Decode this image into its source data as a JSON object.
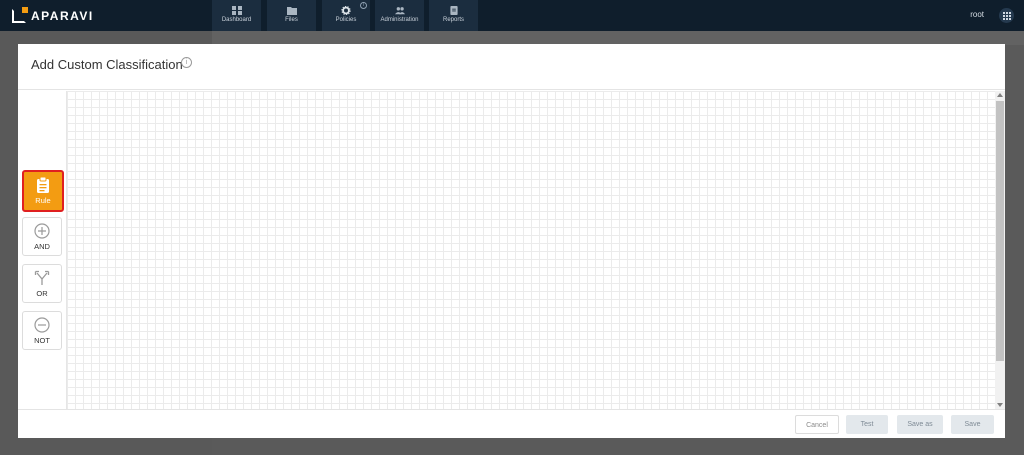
{
  "app": {
    "brand": "APARAVI",
    "user": "root",
    "nav": [
      {
        "label": "Dashboard",
        "icon": "dashboard-icon"
      },
      {
        "label": "Files",
        "icon": "folder-icon"
      },
      {
        "label": "Policies",
        "icon": "gear-icon"
      },
      {
        "label": "Administration",
        "icon": "users-icon"
      },
      {
        "label": "Reports",
        "icon": "report-icon"
      }
    ]
  },
  "modal": {
    "title": "Add Custom Classification",
    "palette": [
      {
        "label": "Rule",
        "icon": "clipboard-icon",
        "selected": true
      },
      {
        "label": "AND",
        "icon": "plus-circle-icon"
      },
      {
        "label": "OR",
        "icon": "split-arrows-icon"
      },
      {
        "label": "NOT",
        "icon": "minus-circle-icon"
      }
    ],
    "footer": {
      "cancel": "Cancel",
      "test": "Test",
      "save_as": "Save as",
      "save": "Save"
    }
  },
  "colors": {
    "topbar": "#0f1e2c",
    "accent": "#f39c12",
    "selection_border": "#e02020"
  }
}
